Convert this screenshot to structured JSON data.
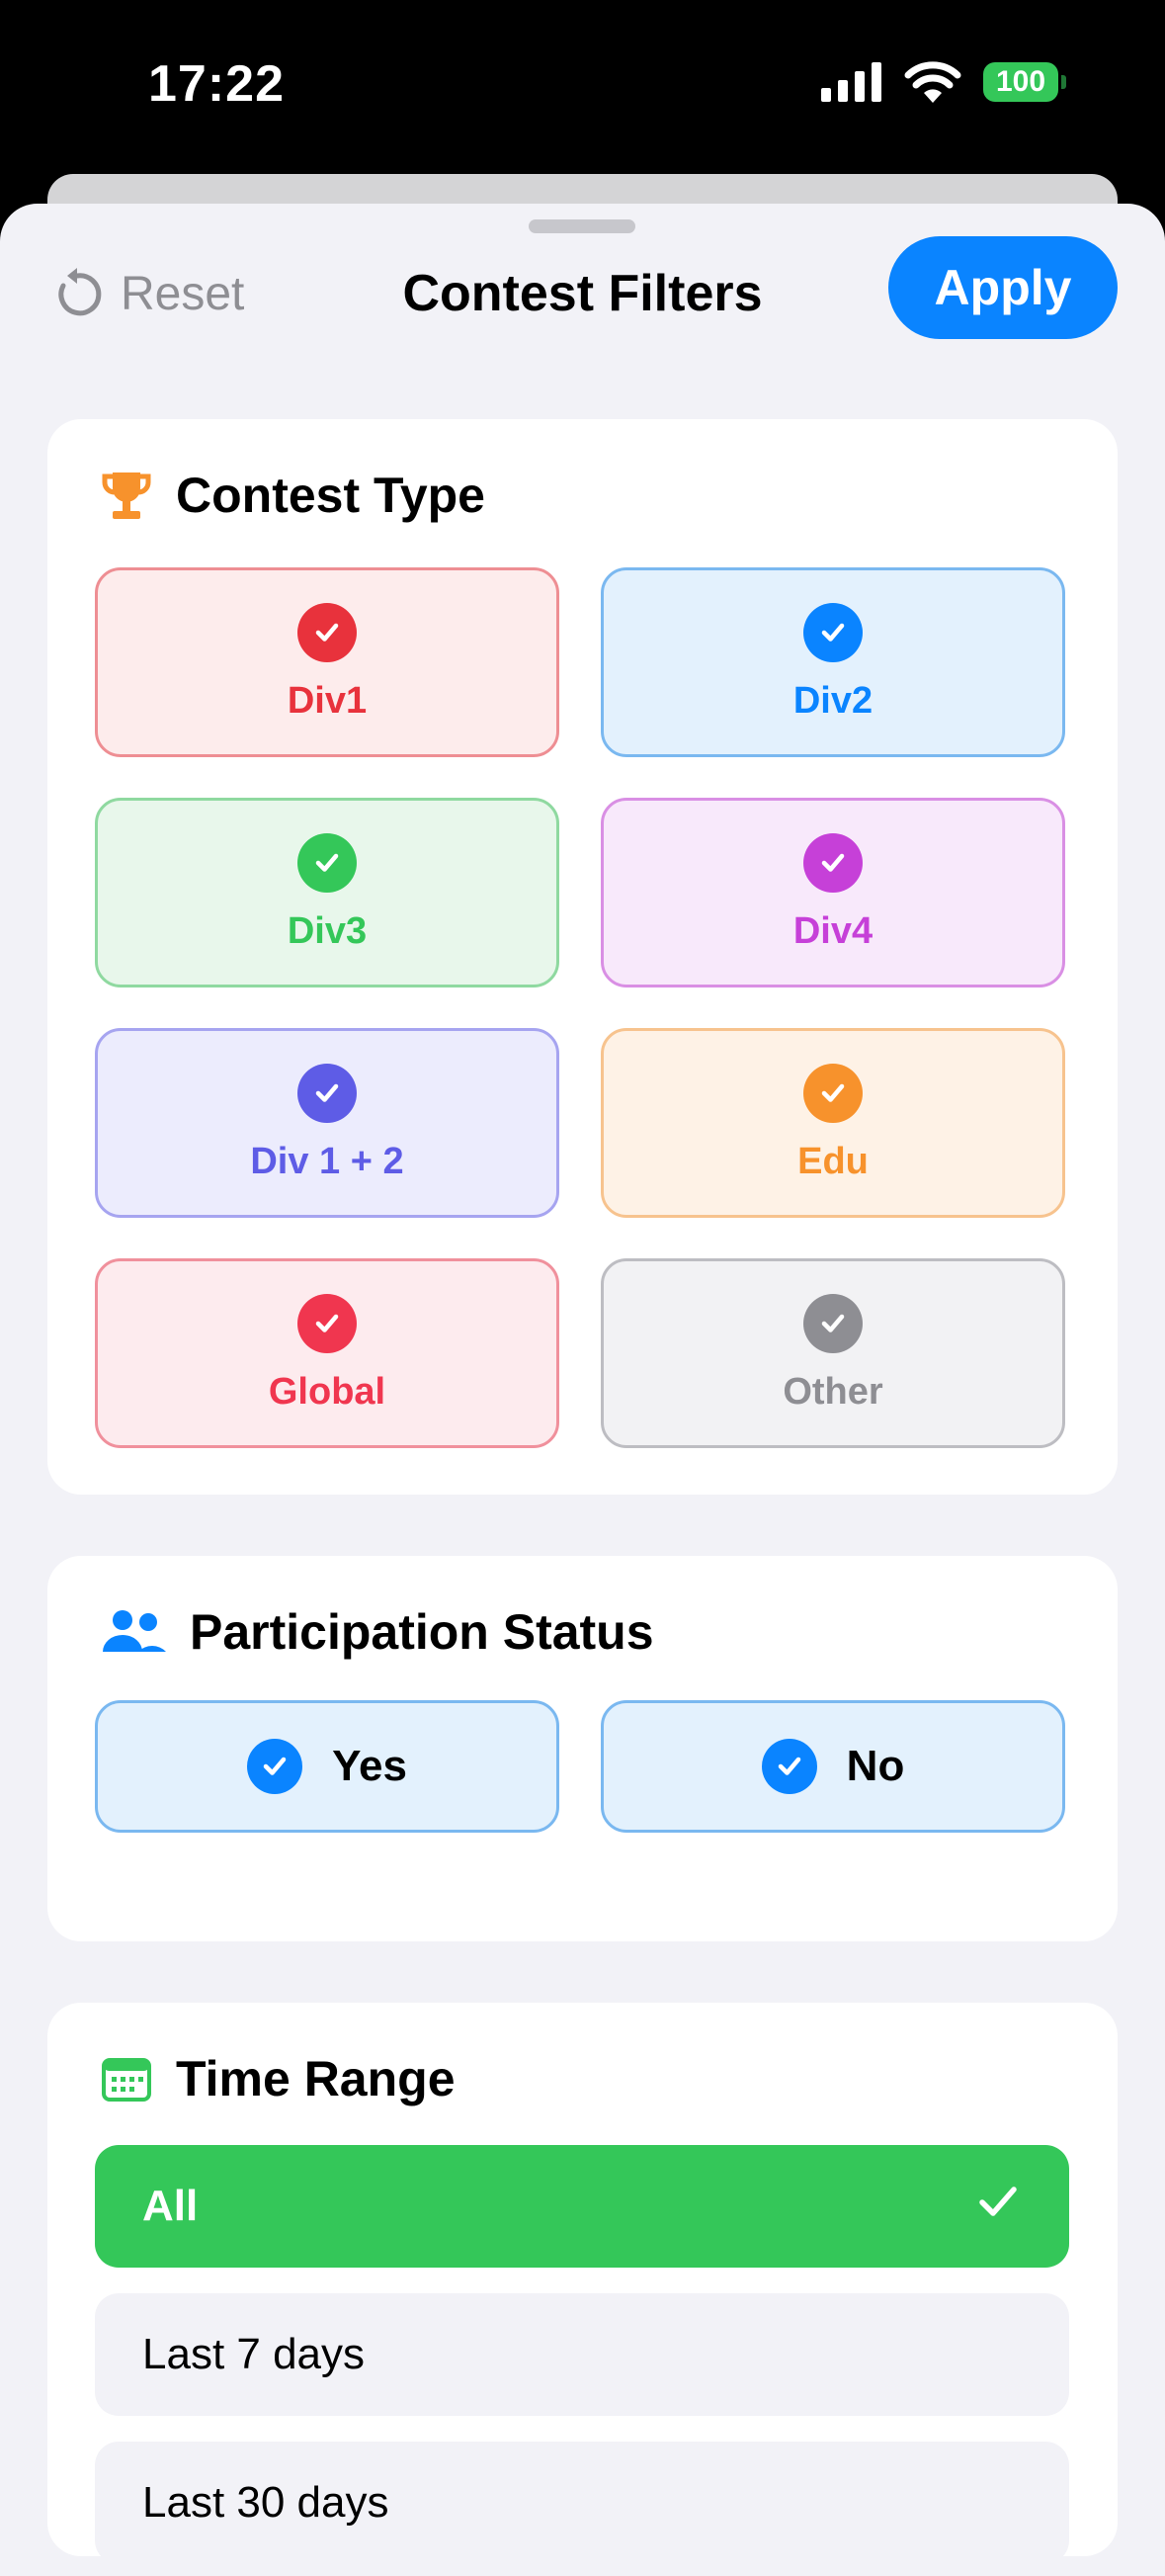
{
  "status_bar": {
    "time": "17:22",
    "battery": "100"
  },
  "header": {
    "reset_label": "Reset",
    "title": "Contest Filters",
    "apply_label": "Apply"
  },
  "contest_type": {
    "title": "Contest Type",
    "icon": "trophy-icon",
    "items": [
      {
        "label": "Div1",
        "color": "#E8323C",
        "bg": "#FDECEC",
        "border": "#EE8E93",
        "selected": true
      },
      {
        "label": "Div2",
        "color": "#0A84FF",
        "bg": "#E3F1FD",
        "border": "#7AB8F0",
        "selected": true
      },
      {
        "label": "Div3",
        "color": "#34C759",
        "bg": "#E8F7EB",
        "border": "#8FD9A0",
        "selected": true
      },
      {
        "label": "Div4",
        "color": "#C640D8",
        "bg": "#F8E9FB",
        "border": "#D98FE4",
        "selected": true
      },
      {
        "label": "Div 1 + 2",
        "color": "#5E5CE6",
        "bg": "#ECECFD",
        "border": "#A6A4F0",
        "selected": true
      },
      {
        "label": "Edu",
        "color": "#F7922C",
        "bg": "#FEF2E6",
        "border": "#F7C38E",
        "selected": true
      },
      {
        "label": "Global",
        "color": "#F0364F",
        "bg": "#FDEBEE",
        "border": "#F0909C",
        "selected": true
      },
      {
        "label": "Other",
        "color": "#8E8E93",
        "bg": "#F2F2F4",
        "border": "#BDBDC2",
        "selected": true
      }
    ]
  },
  "participation": {
    "title": "Participation Status",
    "icon": "people-icon",
    "items": [
      {
        "label": "Yes",
        "selected": true
      },
      {
        "label": "No",
        "selected": true
      }
    ]
  },
  "time_range": {
    "title": "Time Range",
    "icon": "calendar-icon",
    "options": [
      {
        "label": "All",
        "selected": true
      },
      {
        "label": "Last 7 days",
        "selected": false
      },
      {
        "label": "Last 30 days",
        "selected": false
      }
    ]
  }
}
